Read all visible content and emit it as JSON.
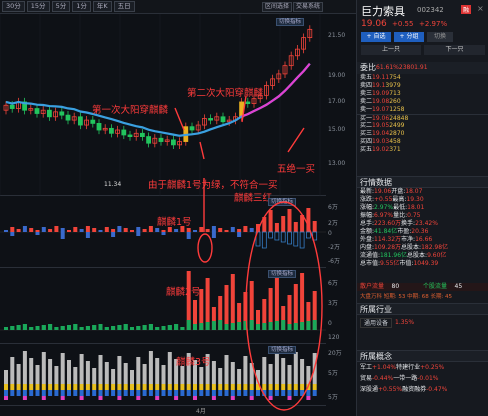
{
  "toolbar": {
    "periods": [
      "30分",
      "15分",
      "5分",
      "1分",
      "年K",
      "五日"
    ],
    "right_buttons": [
      "区间选择",
      "交易系统"
    ]
  },
  "price_axis": [
    "21.50",
    "19.00",
    "17.00",
    "15.00",
    "13.00"
  ],
  "low_label": "11.34",
  "pane_labels": {
    "k": "切换指标",
    "p1": "切换指标",
    "p2": "切换指标",
    "p3": "切换指标"
  },
  "annotations": {
    "first": "第一次大阳穿麒麟",
    "second": "第二次大阳穿麒麟",
    "five": "五绝一买",
    "because": "由于麒麟1号为绿，不符合一买",
    "red3": "麒麟三红",
    "k1": "麒麟1号",
    "k2": "麒麟2号",
    "k3": "麒麟3号"
  },
  "axis1": [
    "6万",
    "2万",
    "0",
    "-2万",
    "-6万"
  ],
  "axis2": [
    "6万",
    "3万",
    "0",
    "120"
  ],
  "axis3": [
    "20万",
    "5万",
    "5万"
  ],
  "bottom_label": "4月",
  "stock": {
    "name": "巨力索具",
    "code": "002342",
    "badge": "融",
    "price": "19.06",
    "change": "+0.55",
    "pct": "+2.97%"
  },
  "actions": {
    "add": "+ 自选",
    "share": "+ 分组",
    "chart": "切换",
    "prev": "上一只",
    "next": "下一只"
  },
  "order_book": {
    "title": "委比",
    "ratio": "61.61%",
    "diff": "23801.91",
    "rows": [
      [
        "卖五",
        "19.11",
        "754"
      ],
      [
        "卖四",
        "19.1",
        "3979"
      ],
      [
        "卖三",
        "19.09",
        "713"
      ],
      [
        "卖二",
        "19.08",
        "260"
      ],
      [
        "卖一",
        "19.07",
        "1258"
      ],
      [
        "买一",
        "19.06",
        "24848"
      ],
      [
        "买二",
        "19.05",
        "2499"
      ],
      [
        "买三",
        "19.04",
        "2870"
      ],
      [
        "买四",
        "19.03",
        "458"
      ],
      [
        "买五",
        "19.02",
        "371"
      ]
    ]
  },
  "quote": {
    "title": "行情数据",
    "rows": [
      [
        "最新:",
        "19.06",
        "开盘:",
        "18.07"
      ],
      [
        "涨跌:",
        "+0.55",
        "最高:",
        "19.30"
      ],
      [
        "涨幅:",
        "2.97%",
        "最低:",
        "18.01"
      ],
      [
        "振幅:",
        "6.97%",
        "量比:",
        "0.75"
      ],
      [
        "总手:",
        "223.60万",
        "换手:",
        "23.42%"
      ],
      [
        "金额:",
        "41.84亿",
        "市盈:",
        "20.36"
      ],
      [
        "外盘:",
        "114.32万",
        "市净:",
        "16.66"
      ],
      [
        "内盘:",
        "109.28万",
        "总股本:",
        "182.98亿"
      ],
      [
        "流通值:",
        "181.96亿",
        "总股本:",
        "9.60亿"
      ],
      [
        "总市值:",
        "9.55亿",
        "市值:",
        "1049.39"
      ]
    ]
  },
  "depth": {
    "buy_label": "散户流量",
    "buy": "80",
    "sell_label": "个股流量",
    "sell": "45"
  },
  "bar_text": "大盘万科 短期: 53 中期: 68 长期: 45",
  "industry": {
    "title": "所属行业",
    "item": "通用设备",
    "pct": "1.35%"
  },
  "concept": {
    "title": "所属概念",
    "items": [
      [
        "军工",
        "+1.04%",
        "特建行业",
        "+0.25%"
      ],
      [
        "贸易",
        "-0.44%",
        "一带一路",
        "-0.01%"
      ],
      [
        "深股通",
        "+0.55%",
        "融资融券",
        "-0.47%"
      ]
    ]
  },
  "colors": {
    "up": "#f0443a",
    "down": "#22c55e",
    "ma": "#3aa0e0",
    "ma2": "#e040d0",
    "accent": "#ff3b3b"
  }
}
